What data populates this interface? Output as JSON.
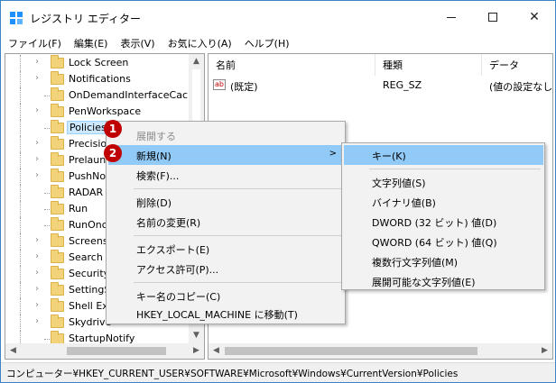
{
  "window": {
    "title": "レジストリ エディター"
  },
  "menubar": [
    "ファイル(F)",
    "編集(E)",
    "表示(V)",
    "お気に入り(A)",
    "ヘルプ(H)"
  ],
  "tree": {
    "items": [
      {
        "label": "Lock Screen",
        "expander": true
      },
      {
        "label": "Notifications",
        "expander": true
      },
      {
        "label": "OnDemandInterfaceCach",
        "expander": false
      },
      {
        "label": "PenWorkspace",
        "expander": true
      },
      {
        "label": "Policies",
        "expander": false,
        "selected": true
      },
      {
        "label": "Precisio",
        "expander": true
      },
      {
        "label": "Prelaun",
        "expander": true
      },
      {
        "label": "PushNo",
        "expander": true
      },
      {
        "label": "RADAR",
        "expander": false
      },
      {
        "label": "Run",
        "expander": false
      },
      {
        "label": "RunOnc",
        "expander": false
      },
      {
        "label": "Screens",
        "expander": true
      },
      {
        "label": "Search",
        "expander": true
      },
      {
        "label": "Security",
        "expander": true
      },
      {
        "label": "SettingS",
        "expander": true
      },
      {
        "label": "Shell Ext",
        "expander": true
      },
      {
        "label": "Skydrive",
        "expander": true
      },
      {
        "label": "StartupNotify",
        "expander": false
      }
    ]
  },
  "list": {
    "columns": [
      "名前",
      "種類",
      "データ"
    ],
    "rows": [
      {
        "icon": "ab",
        "name": "(既定)",
        "type": "REG_SZ",
        "data": "(値の設定なし"
      }
    ]
  },
  "context_menu": {
    "items": [
      {
        "label": "展開する",
        "disabled": true
      },
      {
        "label": "新規(N)",
        "highlighted": true,
        "has_submenu": true,
        "arrow": ">"
      },
      {
        "label": "検索(F)..."
      },
      {
        "separator": true
      },
      {
        "label": "削除(D)"
      },
      {
        "label": "名前の変更(R)"
      },
      {
        "separator": true
      },
      {
        "label": "エクスポート(E)"
      },
      {
        "label": "アクセス許可(P)..."
      },
      {
        "separator": true
      },
      {
        "label": "キー名のコピー(C)"
      },
      {
        "label": "HKEY_LOCAL_MACHINE に移動(T)"
      }
    ]
  },
  "submenu": {
    "items": [
      {
        "label": "キー(K)",
        "highlighted": true
      },
      {
        "separator": true
      },
      {
        "label": "文字列値(S)"
      },
      {
        "label": "バイナリ値(B)"
      },
      {
        "label": "DWORD (32 ビット) 値(D)"
      },
      {
        "label": "QWORD (64 ビット) 値(Q)"
      },
      {
        "label": "複数行文字列値(M)"
      },
      {
        "label": "展開可能な文字列値(E)"
      }
    ]
  },
  "badges": [
    "1",
    "2"
  ],
  "statusbar": {
    "path": "コンピューター¥HKEY_CURRENT_USER¥SOFTWARE¥Microsoft¥Windows¥CurrentVersion¥Policies"
  },
  "colors": {
    "highlight": "#91c9f7",
    "badge": "#c00000",
    "border_accent": "#3c82c8"
  }
}
